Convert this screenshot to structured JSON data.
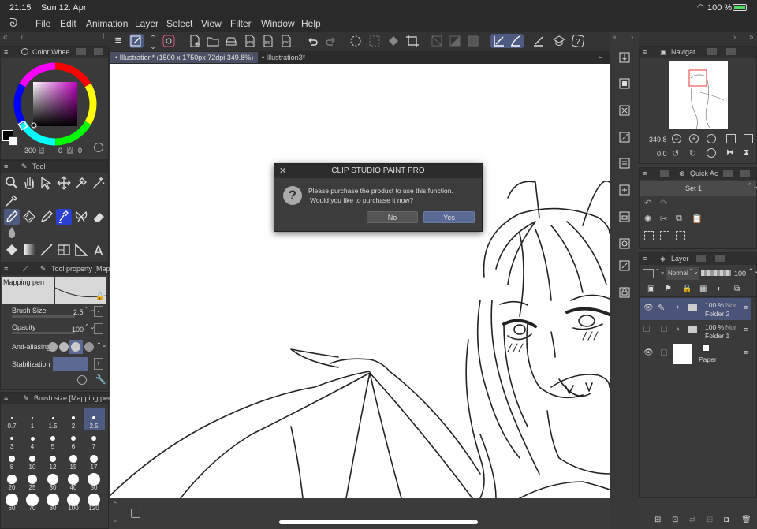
{
  "status": {
    "time": "21:15",
    "date": "Sun 12. Apr",
    "battery": "100 %"
  },
  "menu": [
    "File",
    "Edit",
    "Animation",
    "Layer",
    "Select",
    "View",
    "Filter",
    "Window",
    "Help"
  ],
  "tabs": [
    {
      "label": "Illustration* (1500 x 1750px 72dpi 349.8%)"
    },
    {
      "label": "Illustration3*"
    }
  ],
  "color_wheel": {
    "title": "Color Whee",
    "h": "300",
    "s": "0",
    "v": "0"
  },
  "tool_panel": {
    "title": "Tool"
  },
  "tool_property": {
    "title": "Tool property [Map",
    "preset": "Mapping pen",
    "brush_size_label": "Brush Size",
    "brush_size": "2.5",
    "opacity_label": "Opacity",
    "opacity": "100",
    "antialias_label": "Anti-aliasing",
    "stabilization_label": "Stabilization"
  },
  "brush_size_panel": {
    "title": "Brush size [Mapping pen]",
    "sizes": [
      "0.7",
      "1",
      "1.5",
      "2",
      "2.5",
      "3",
      "4",
      "5",
      "6",
      "7",
      "8",
      "10",
      "12",
      "15",
      "17",
      "20",
      "25",
      "30",
      "40",
      "50",
      "60",
      "70",
      "80",
      "100",
      "120"
    ]
  },
  "dialog": {
    "title": "CLIP STUDIO PAINT PRO",
    "line1": "Please purchase the product to use this function.",
    "line2": "Would you like to purchase it now?",
    "no": "No",
    "yes": "Yes"
  },
  "navigator": {
    "title": "Navigat",
    "zoom": "349.8",
    "rotation": "0.0"
  },
  "quick_access": {
    "title": "Quick Ac",
    "set": "Set 1"
  },
  "layer_panel": {
    "title": "Layer",
    "blend": "Normal",
    "opacity": "100",
    "layers": [
      {
        "pct": "100 %",
        "mode": "Nor",
        "name": "Folder 2"
      },
      {
        "pct": "100 %",
        "mode": "Nor",
        "name": "Folder 1"
      },
      {
        "name": "Paper"
      }
    ]
  },
  "colors": {
    "accent": "#4d5a82",
    "selected_layer": "#4a5478",
    "dialog_yes": "#5a6a96"
  }
}
